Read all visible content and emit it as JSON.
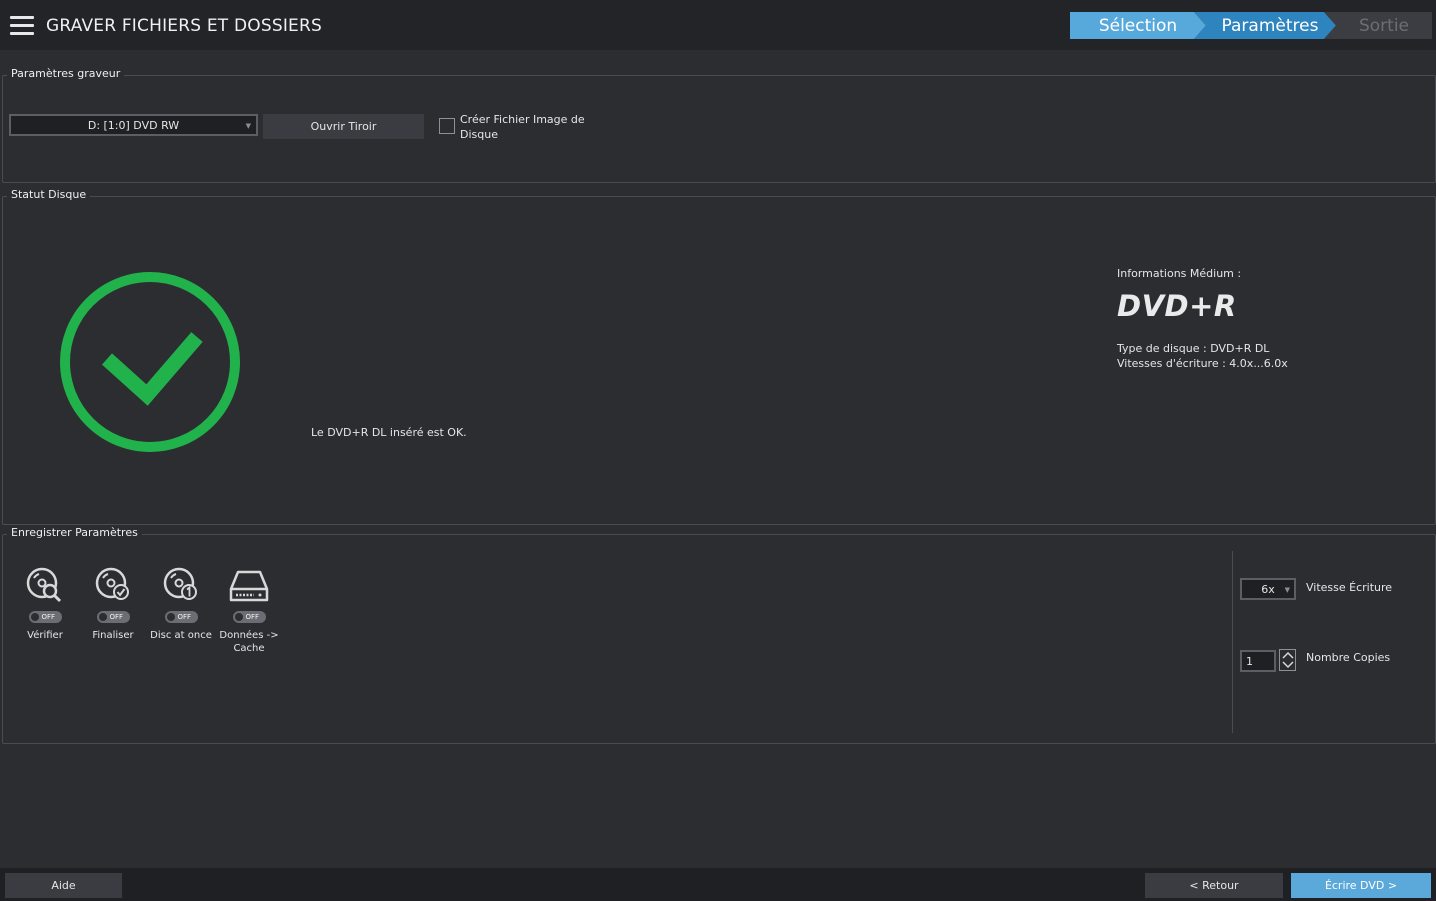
{
  "header": {
    "title": "GRAVER FICHIERS ET DOSSIERS",
    "steps": [
      "Sélection",
      "Paramètres",
      "Sortie"
    ]
  },
  "burner": {
    "legend": "Paramètres graveur",
    "drive": "D: [1:0] DVD RW",
    "open_tray": "Ouvrir Tiroir",
    "create_image_label": "Créer Fichier Image de Disque",
    "create_image_checked": false
  },
  "disc_status": {
    "legend": "Statut Disque",
    "message": "Le DVD+R DL inséré est OK.",
    "media_info_title": "Informations Médium :",
    "media_name": "DVD+R",
    "disc_type": "Type de disque : DVD+R DL",
    "write_speeds": "Vitesses d'écriture : 4.0x...6.0x",
    "status_color": "#22b24c"
  },
  "record_settings": {
    "legend": "Enregistrer Paramètres",
    "options": [
      {
        "label": "Vérifier",
        "state": "OFF",
        "icon": "disc-search-icon"
      },
      {
        "label": "Finaliser",
        "state": "OFF",
        "icon": "disc-check-icon"
      },
      {
        "label": "Disc at once",
        "state": "OFF",
        "icon": "disc-one-icon"
      },
      {
        "label": "Données -> Cache",
        "state": "OFF",
        "icon": "drive-cache-icon"
      }
    ],
    "write_speed_value": "6x",
    "write_speed_label": "Vitesse Écriture",
    "copies_value": "1",
    "copies_label": "Nombre Copies"
  },
  "footer": {
    "help": "Aide",
    "back": "< Retour",
    "write": "Écrire DVD >"
  },
  "colors": {
    "accent": "#57a9dc",
    "accent_dark": "#2e84bf",
    "ok_green": "#22b24c"
  }
}
